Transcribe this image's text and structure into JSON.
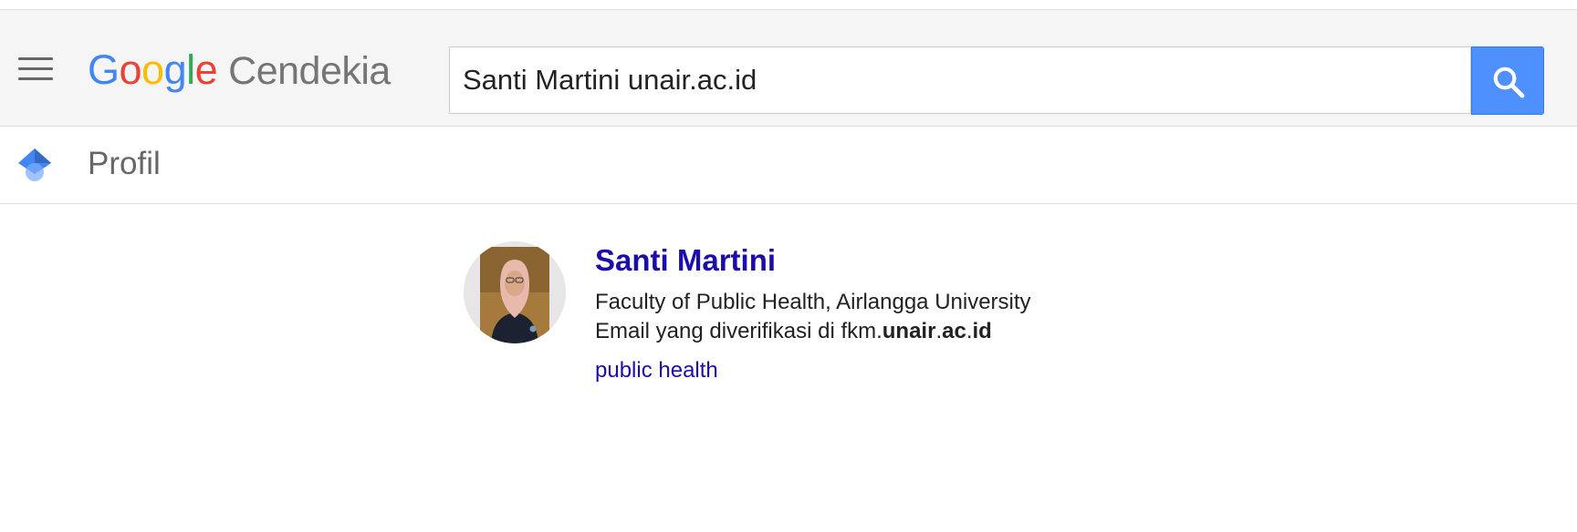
{
  "header": {
    "logo": {
      "letters": [
        "G",
        "o",
        "o",
        "g",
        "l",
        "e"
      ],
      "product": "Cendekia"
    },
    "search": {
      "value": "Santi Martini unair.ac.id",
      "placeholder": ""
    },
    "icons": {
      "menu": "hamburger-menu-icon",
      "search": "search-icon"
    }
  },
  "subheader": {
    "icon": "scholar-cap-icon",
    "title": "Profil"
  },
  "result": {
    "name": "Santi Martini",
    "affiliation": "Faculty of Public Health, Airlangga University",
    "email_prefix": "Email yang diverifikasi di fkm.",
    "email_domain_1": "unair",
    "email_dot_1": ".",
    "email_domain_2": "ac",
    "email_dot_2": ".",
    "email_domain_3": "id",
    "interests": [
      "public health"
    ]
  },
  "colors": {
    "link": "#1a0dab",
    "search_button": "#4d90fe",
    "header_bg": "#f5f5f5",
    "google_blue": "#4285f4",
    "google_red": "#ea4335",
    "google_yellow": "#fbbc05",
    "google_green": "#34a853"
  }
}
